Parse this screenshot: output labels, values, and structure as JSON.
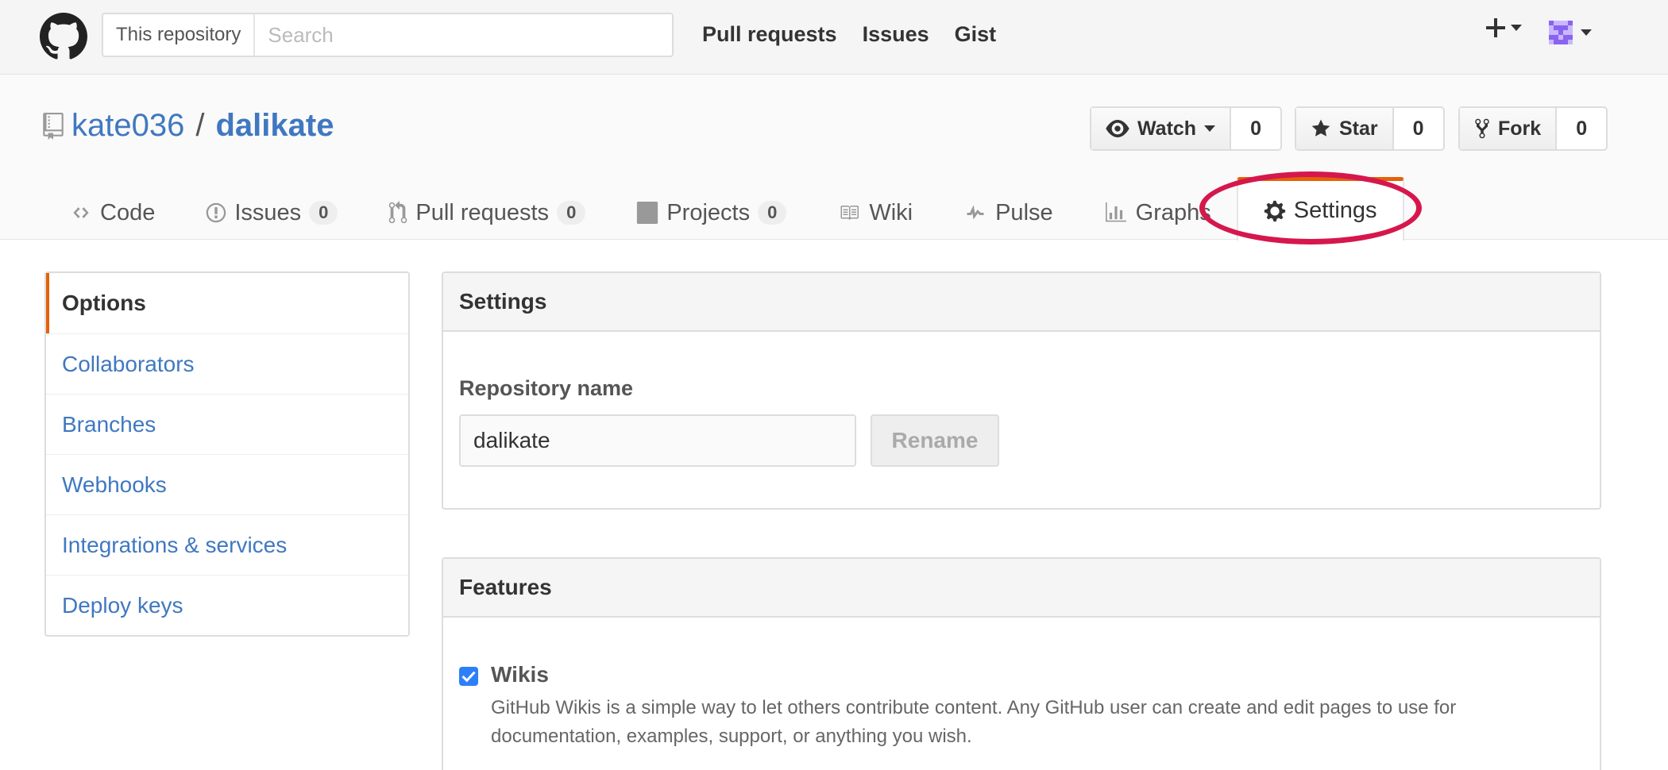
{
  "header": {
    "search_scope": "This repository",
    "search_placeholder": "Search",
    "nav": [
      "Pull requests",
      "Issues",
      "Gist"
    ]
  },
  "repo": {
    "owner": "kate036",
    "separator": "/",
    "name": "dalikate",
    "watch_label": "Watch",
    "watch_count": "0",
    "star_label": "Star",
    "star_count": "0",
    "fork_label": "Fork",
    "fork_count": "0"
  },
  "tabs": [
    {
      "label": "Code",
      "count": null
    },
    {
      "label": "Issues",
      "count": "0"
    },
    {
      "label": "Pull requests",
      "count": "0"
    },
    {
      "label": "Projects",
      "count": "0"
    },
    {
      "label": "Wiki",
      "count": null
    },
    {
      "label": "Pulse",
      "count": null
    },
    {
      "label": "Graphs",
      "count": null
    },
    {
      "label": "Settings",
      "count": null,
      "selected": true
    }
  ],
  "sidebar": {
    "items": [
      {
        "label": "Options",
        "active": true
      },
      {
        "label": "Collaborators"
      },
      {
        "label": "Branches"
      },
      {
        "label": "Webhooks"
      },
      {
        "label": "Integrations & services"
      },
      {
        "label": "Deploy keys"
      }
    ]
  },
  "settings_box": {
    "title": "Settings",
    "repo_name_label": "Repository name",
    "repo_name_value": "dalikate",
    "rename_label": "Rename"
  },
  "features_box": {
    "title": "Features",
    "wikis_title": "Wikis",
    "wikis_checked": true,
    "wikis_desc": "GitHub Wikis is a simple way to let others contribute content. Any GitHub user can create and edit pages to use for documentation, examples, support, or anything you wish."
  },
  "colors": {
    "link": "#4078c0",
    "accent_orange": "#e36209",
    "annotation_red": "#d6174c",
    "checkbox_blue": "#2d7ff9"
  },
  "icons": [
    "github-logo-icon",
    "plus-icon",
    "avatar-icon",
    "repo-icon",
    "eye-icon",
    "star-icon",
    "fork-icon",
    "code-icon",
    "issue-icon",
    "pull-request-icon",
    "project-icon",
    "wiki-icon",
    "pulse-icon",
    "graph-icon",
    "gear-icon",
    "check-icon"
  ]
}
